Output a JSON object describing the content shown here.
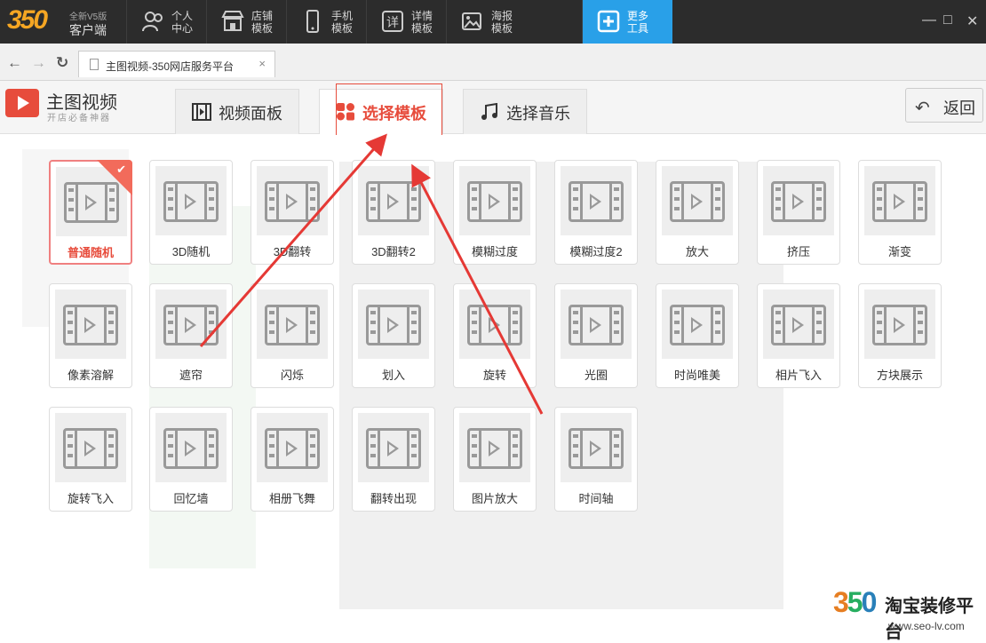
{
  "topbar": {
    "brand": "350",
    "version": "全新V5版",
    "client": "客户端",
    "nav": [
      {
        "label": "个人中心",
        "icon": "users-icon"
      },
      {
        "label": "店铺模板",
        "icon": "store-icon"
      },
      {
        "label": "手机模板",
        "icon": "phone-icon"
      },
      {
        "label": "详情模板",
        "icon": "detail-icon"
      },
      {
        "label": "海报模板",
        "icon": "image-icon"
      },
      {
        "label": "更多工具",
        "icon": "plus-icon"
      }
    ],
    "window_controls": {
      "minimize": "—",
      "maximize": "□",
      "close": "✕"
    }
  },
  "browser": {
    "back": "←",
    "forward": "→",
    "refresh": "↻",
    "tab_title": "主图视频-350网店服务平台",
    "tab_close": "×"
  },
  "app": {
    "title": "主图视频",
    "subtitle": "开店必备神器",
    "tabs": [
      {
        "label": "视频面板",
        "icon": "film-icon"
      },
      {
        "label": "选择模板",
        "icon": "grid-icon"
      },
      {
        "label": "选择音乐",
        "icon": "music-icon"
      }
    ],
    "back_label": "返回"
  },
  "templates": [
    [
      "普通随机",
      "3D随机",
      "3D翻转",
      "3D翻转2",
      "模糊过度",
      "模糊过度2",
      "放大",
      "挤压",
      "渐变"
    ],
    [
      "像素溶解",
      "遮帘",
      "闪烁",
      "划入",
      "旋转",
      "光圈",
      "时尚唯美",
      "相片飞入",
      "方块展示"
    ],
    [
      "旋转飞入",
      "回忆墙",
      "相册飞舞",
      "翻转出现",
      "图片放大",
      "时间轴"
    ]
  ],
  "selected_template": "普通随机",
  "colors": {
    "accent": "#e74c3c",
    "active_nav": "#29a0e8",
    "arrow": "#e53935"
  },
  "watermark": {
    "number": "350",
    "text": "淘宝装修平台",
    "url": "www.seo-lv.com"
  }
}
